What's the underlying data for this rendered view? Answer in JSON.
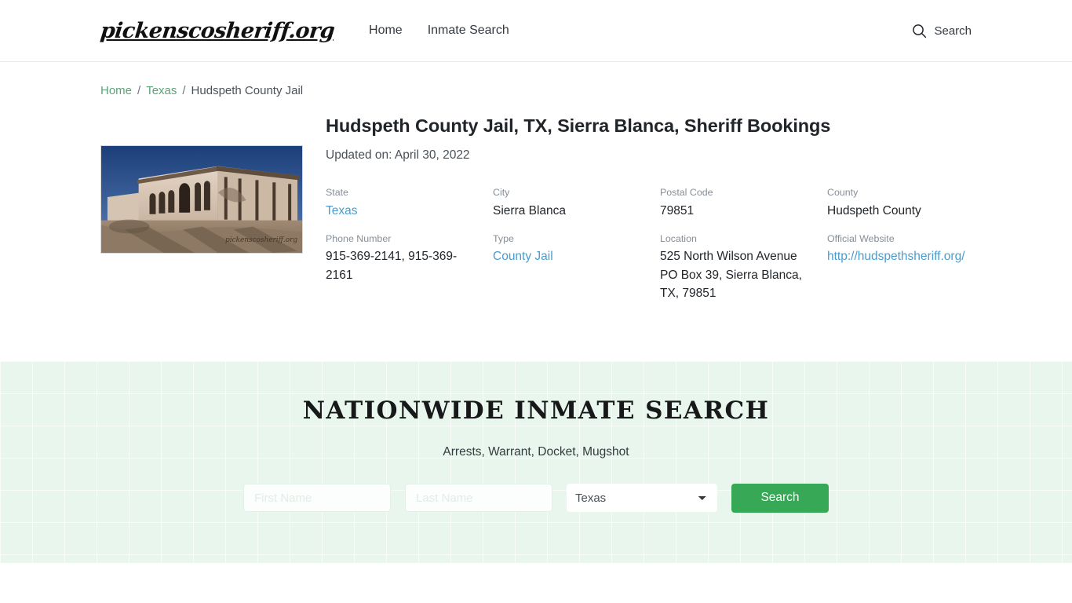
{
  "header": {
    "brand": "pickenscosheriff.org",
    "nav": [
      {
        "label": "Home"
      },
      {
        "label": "Inmate Search"
      }
    ],
    "search_label": "Search",
    "search_icon": "search-icon"
  },
  "breadcrumb": {
    "items": [
      {
        "label": "Home",
        "type": "link"
      },
      {
        "label": "Texas",
        "type": "link"
      },
      {
        "label": "Hudspeth County Jail",
        "type": "current"
      }
    ],
    "separator": "/"
  },
  "main": {
    "title": "Hudspeth County Jail, TX, Sierra Blanca, Sheriff Bookings",
    "updated": "Updated on: April 30, 2022",
    "photo_alt": "Hudspeth County Jail building",
    "photo_watermark": "pickenscosheriff.org",
    "details": [
      {
        "label": "State",
        "value": "Texas",
        "link": true
      },
      {
        "label": "City",
        "value": "Sierra Blanca",
        "link": false
      },
      {
        "label": "Postal Code",
        "value": "79851",
        "link": false
      },
      {
        "label": "County",
        "value": "Hudspeth County",
        "link": false
      },
      {
        "label": "Phone Number",
        "value": "915-369-2141, 915-369-2161",
        "link": false
      },
      {
        "label": "Type",
        "value": "County Jail",
        "link": true
      },
      {
        "label": "Location",
        "value": "525 North Wilson Avenue PO Box 39, Sierra Blanca, TX, 79851",
        "link": false
      },
      {
        "label": "Official Website",
        "value": "http://hudspethsheriff.org/",
        "link": true
      }
    ]
  },
  "search_section": {
    "title": "NATIONWIDE INMATE SEARCH",
    "subtitle": "Arrests, Warrant, Docket, Mugshot",
    "first_name_placeholder": "First Name",
    "first_name_value": "",
    "last_name_placeholder": "Last Name",
    "last_name_value": "",
    "state_selected": "Texas",
    "state_options": [
      "Texas"
    ],
    "button_label": "Search",
    "button_color": "#37a855",
    "background_color": "#e9f6ee"
  }
}
